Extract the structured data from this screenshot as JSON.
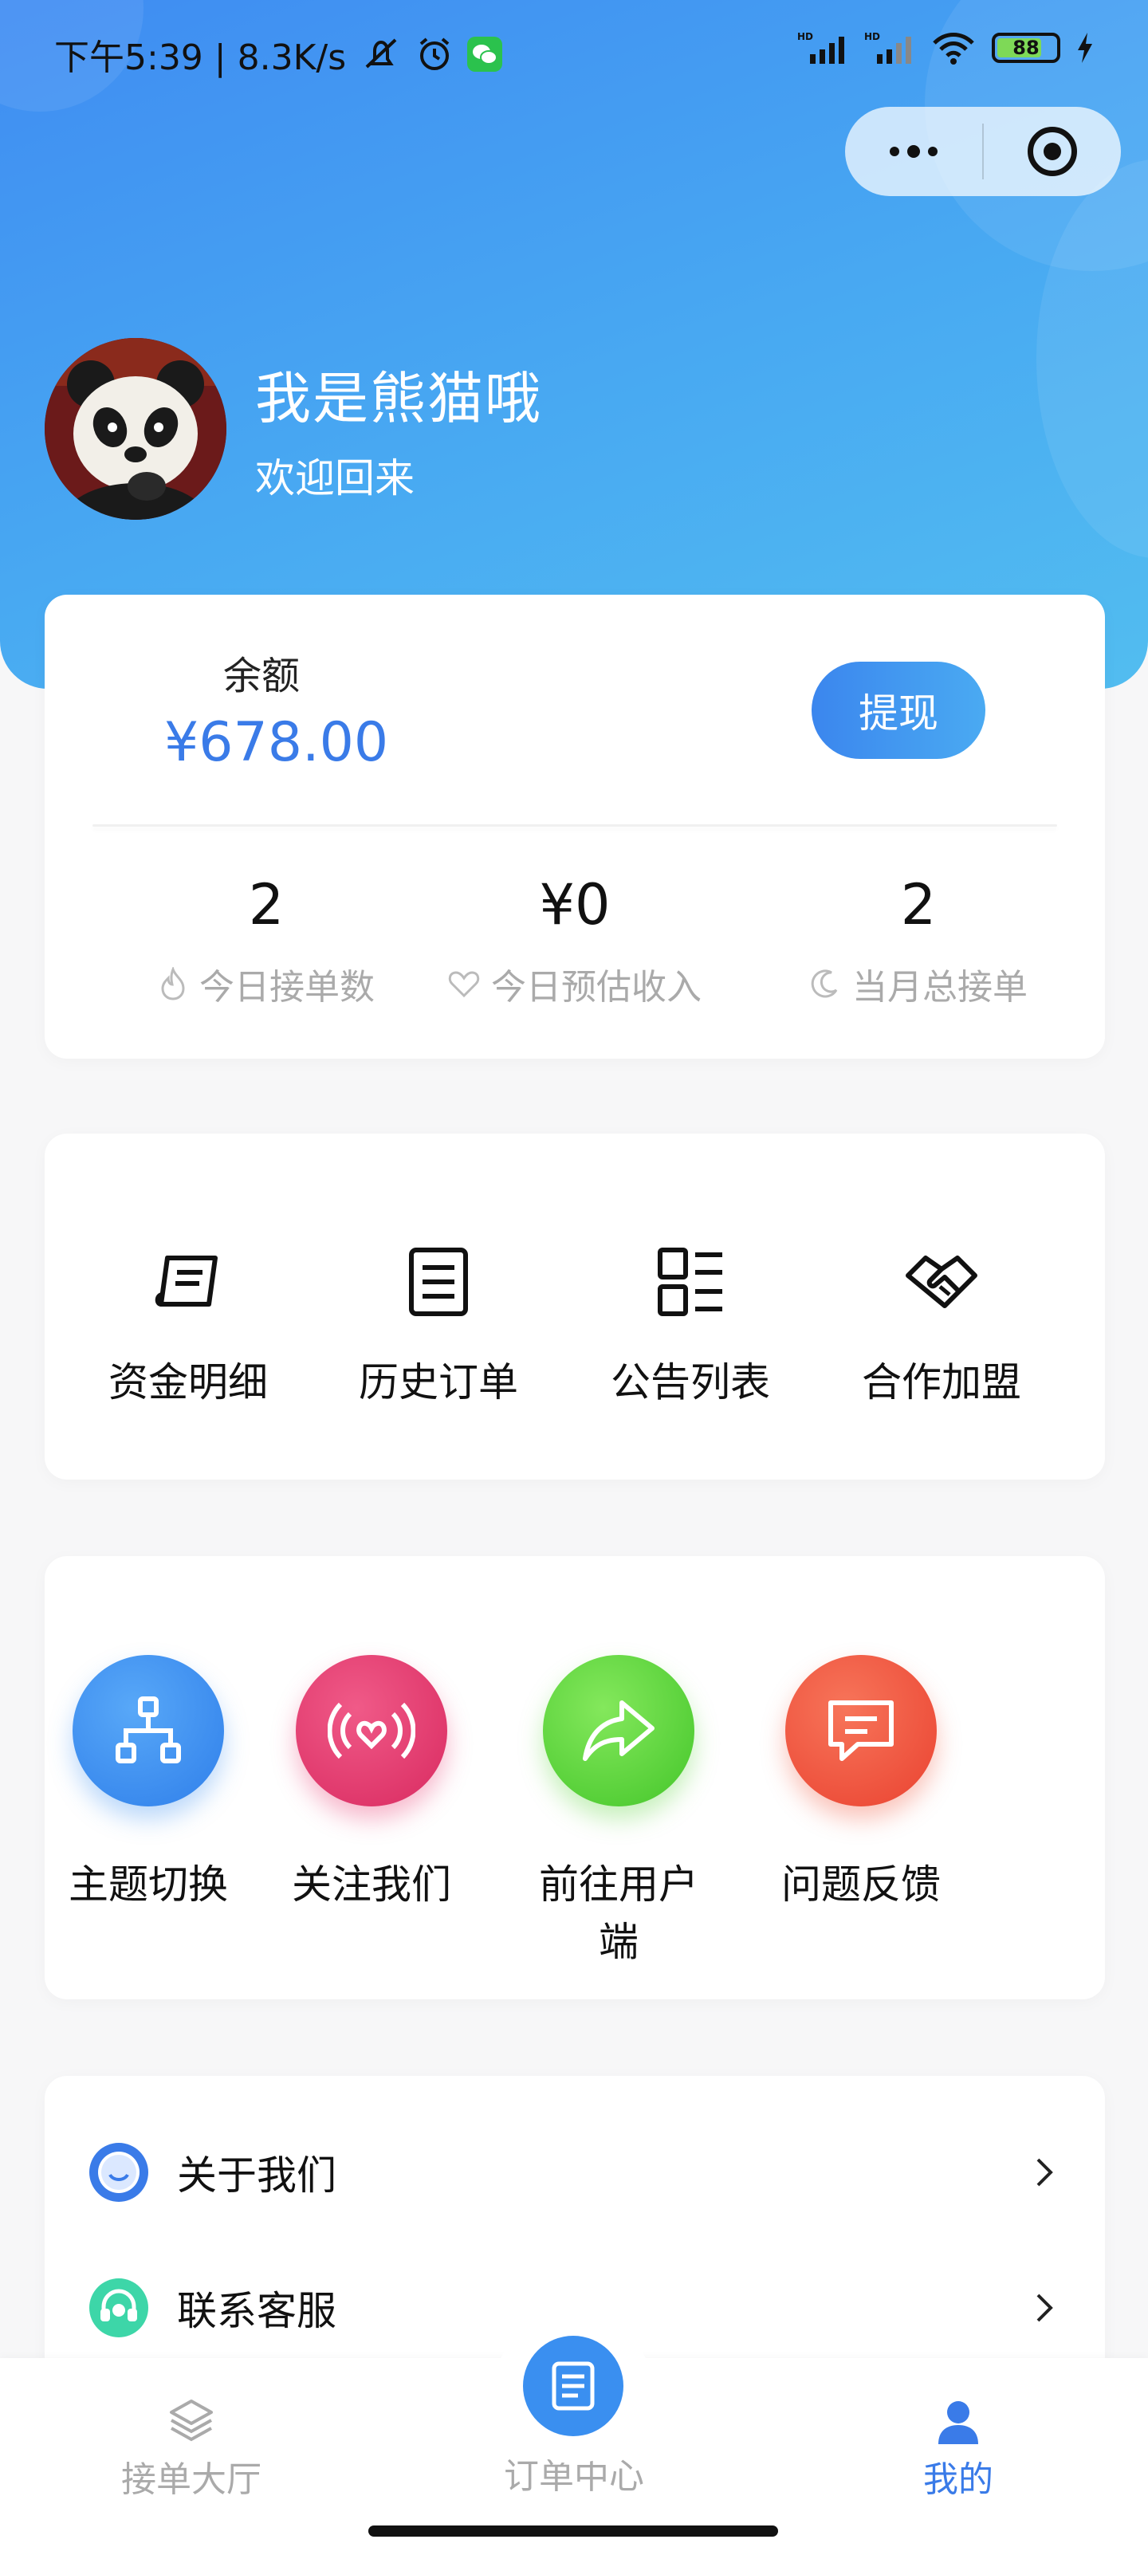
{
  "status_bar": {
    "time_speed": "下午5:39 | 8.3K/s",
    "battery": "88"
  },
  "profile": {
    "name": "我是熊猫哦",
    "welcome": "欢迎回来"
  },
  "balance": {
    "label": "余额",
    "value": "¥678.00",
    "withdraw_label": "提现"
  },
  "stats": [
    {
      "value": "2",
      "label": "今日接单数",
      "icon": "flame-icon"
    },
    {
      "value": "¥0",
      "label": "今日预估收入",
      "icon": "heart-icon"
    },
    {
      "value": "2",
      "label": "当月总接单",
      "icon": "moon-icon"
    }
  ],
  "quick_menu": [
    {
      "label": "资金明细",
      "icon": "receipt-icon"
    },
    {
      "label": "历史订单",
      "icon": "document-list-icon"
    },
    {
      "label": "公告列表",
      "icon": "list-grid-icon"
    },
    {
      "label": "合作加盟",
      "icon": "handshake-icon"
    }
  ],
  "feature_menu": [
    {
      "label": "主题切换",
      "icon": "sitemap-icon",
      "color": "#3b8ef0"
    },
    {
      "label": "关注我们",
      "icon": "broadcast-heart-icon",
      "color": "#e8356e"
    },
    {
      "label": "前往用户端",
      "icon": "share-arrow-icon",
      "color": "#5dd33b"
    },
    {
      "label": "问题反馈",
      "icon": "chat-bubble-icon",
      "color": "#f0533a"
    }
  ],
  "list_menu": [
    {
      "label": "关于我们",
      "icon": "smile-icon",
      "color": "#3a7be8"
    },
    {
      "label": "联系客服",
      "icon": "headset-icon",
      "color": "#3dd6a8"
    }
  ],
  "tabbar": {
    "hall": "接单大厅",
    "orders": "订单中心",
    "mine": "我的",
    "active_color": "#3a7be8"
  }
}
